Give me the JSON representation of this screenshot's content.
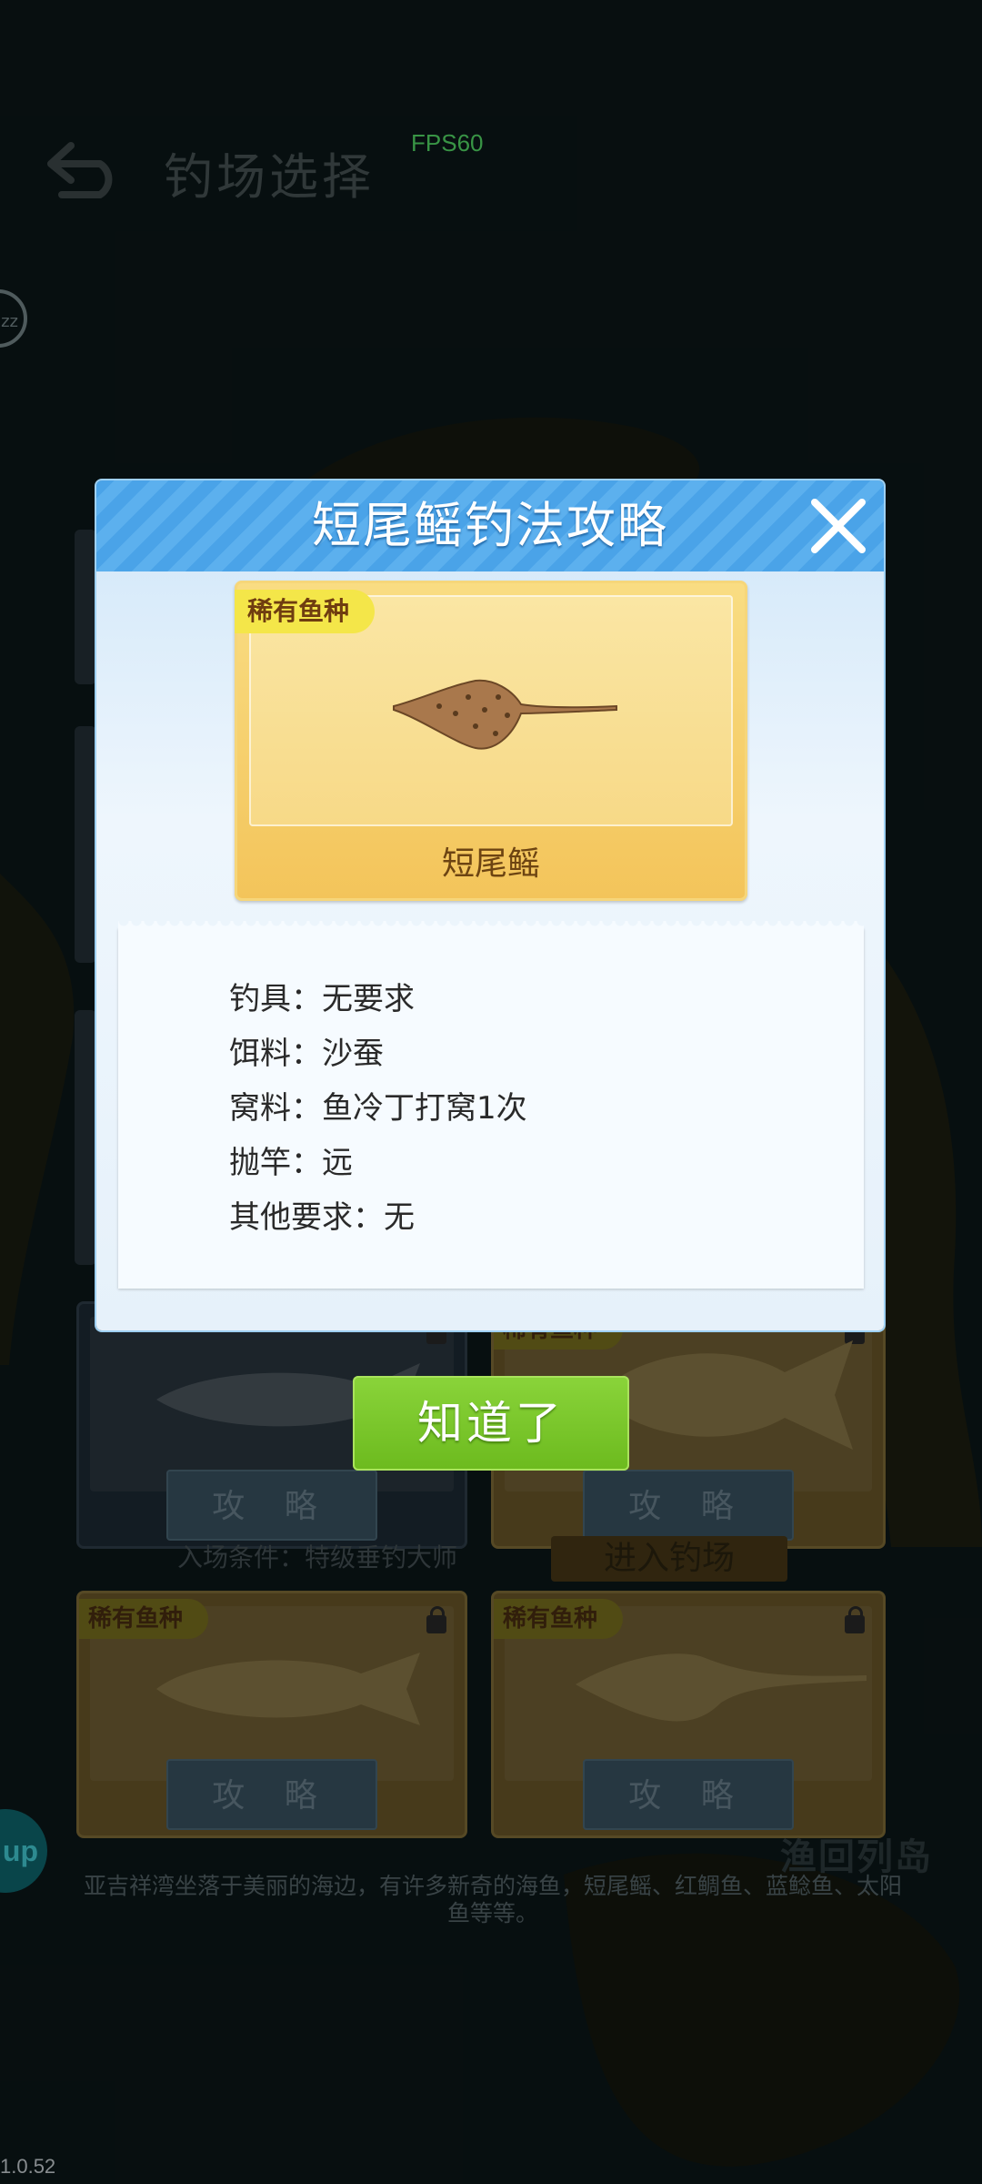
{
  "topbar": {
    "title": "钓场选择",
    "fps": "FPS60"
  },
  "zz_badge": "zz",
  "up_button": "up",
  "version": "1.0.52",
  "map": {
    "island_label": "渔回列岛",
    "description": "亚吉祥湾坐落于美丽的海边，有许多新奇的海鱼，短尾鳐、红鲷鱼、蓝鲶鱼、太阳鱼等等。"
  },
  "background": {
    "enter_button": "进入钓场",
    "enter_requirement": "入场条件：特级垂钓大师",
    "guide_button": "攻 略",
    "rare_tag": "稀有鱼种"
  },
  "modal": {
    "title": "短尾鳐钓法攻略",
    "fish_card": {
      "tag": "稀有鱼种",
      "name": "短尾鳐"
    },
    "info": [
      {
        "label": "钓具：",
        "value": "无要求"
      },
      {
        "label": "饵料：",
        "value": "沙蚕"
      },
      {
        "label": "窝料：",
        "value": "鱼冷丁打窝1次"
      },
      {
        "label": "抛竿：",
        "value": "远"
      },
      {
        "label": "其他要求：",
        "value": "无"
      }
    ],
    "ok_button": "知道了"
  },
  "colors": {
    "accent_blue": "#4aa3e8",
    "ok_green": "#7cc82c",
    "rare_tag_yellow": "#f4e649",
    "gold_card": "#f3c45a"
  }
}
